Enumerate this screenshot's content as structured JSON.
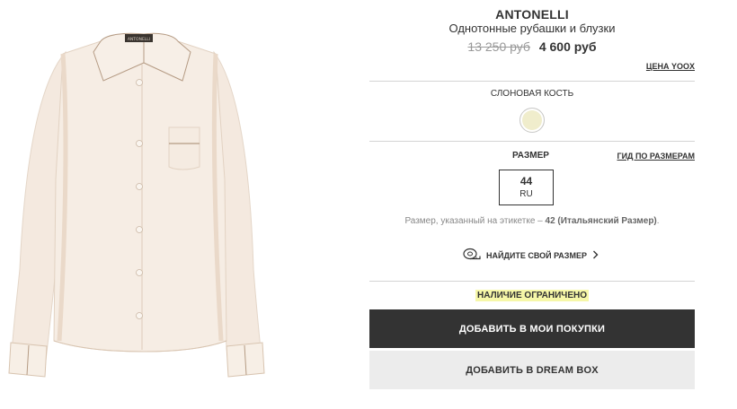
{
  "product": {
    "brand": "ANTONELLI",
    "category": "Однотонные рубашки и блузки",
    "old_price": "13 250 руб",
    "new_price": "4 600 руб",
    "yoox_price_link": "ЦЕНА YOOX",
    "image_label": "ANTONELLI"
  },
  "color": {
    "label": "СЛОНОВАЯ КОСТЬ",
    "swatch_hex": "#f0edcc"
  },
  "size": {
    "label": "РАЗМЕР",
    "guide_link": "ГИД ПО РАЗМЕРАМ",
    "selected_value": "44",
    "selected_unit": "RU",
    "note_prefix": "Размер, указанный на этикетке – ",
    "note_bold": "42 (Итальянский Размер)",
    "note_suffix": ".",
    "find_size": "НАЙДИТЕ СВОЙ РАЗМЕР"
  },
  "availability": "НАЛИЧИЕ ОГРАНИЧЕНО",
  "actions": {
    "add_to_cart": "ДОБАВИТЬ В МОИ ПОКУПКИ",
    "add_to_dreambox": "ДОБАВИТЬ В DREAM BOX"
  },
  "colors": {
    "primary_button": "#333333",
    "secondary_button": "#ececec",
    "availability_highlight": "#f6f7a8"
  },
  "icons": [
    "tape-measure-icon",
    "chevron-right-icon"
  ]
}
